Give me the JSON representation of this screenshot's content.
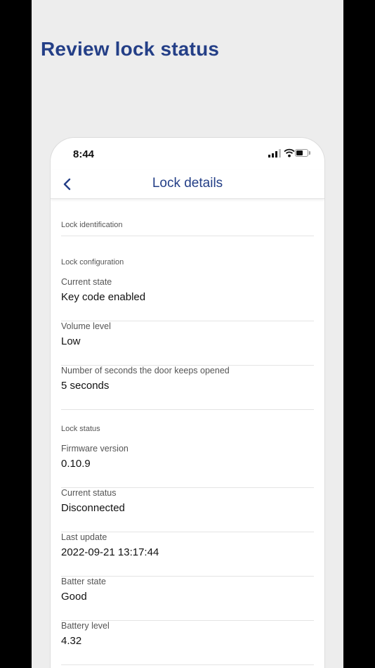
{
  "headline": "Review lock status",
  "status_bar": {
    "time": "8:44"
  },
  "nav": {
    "title": "Lock details"
  },
  "sections": {
    "identification": "Lock identification",
    "configuration": "Lock configuration",
    "status": "Lock status"
  },
  "fields": {
    "current_state": {
      "label": "Current state",
      "value": "Key code enabled"
    },
    "volume_level": {
      "label": "Volume level",
      "value": "Low"
    },
    "door_open_seconds": {
      "label": "Number of seconds the door keeps opened",
      "value": "5 seconds"
    },
    "firmware_version": {
      "label": "Firmware version",
      "value": "0.10.9"
    },
    "current_status": {
      "label": "Current status",
      "value": "Disconnected"
    },
    "last_update": {
      "label": "Last update",
      "value": "2022-09-21 13:17:44"
    },
    "battery_state": {
      "label": "Batter state",
      "value": "Good"
    },
    "battery_level": {
      "label": "Battery level",
      "value": "4.32"
    }
  },
  "colors": {
    "accent": "#243f87",
    "background": "#ededed"
  },
  "icons": {
    "back": "chevron-left-icon",
    "signal": "signal-icon",
    "wifi": "wifi-icon",
    "battery": "battery-icon"
  }
}
